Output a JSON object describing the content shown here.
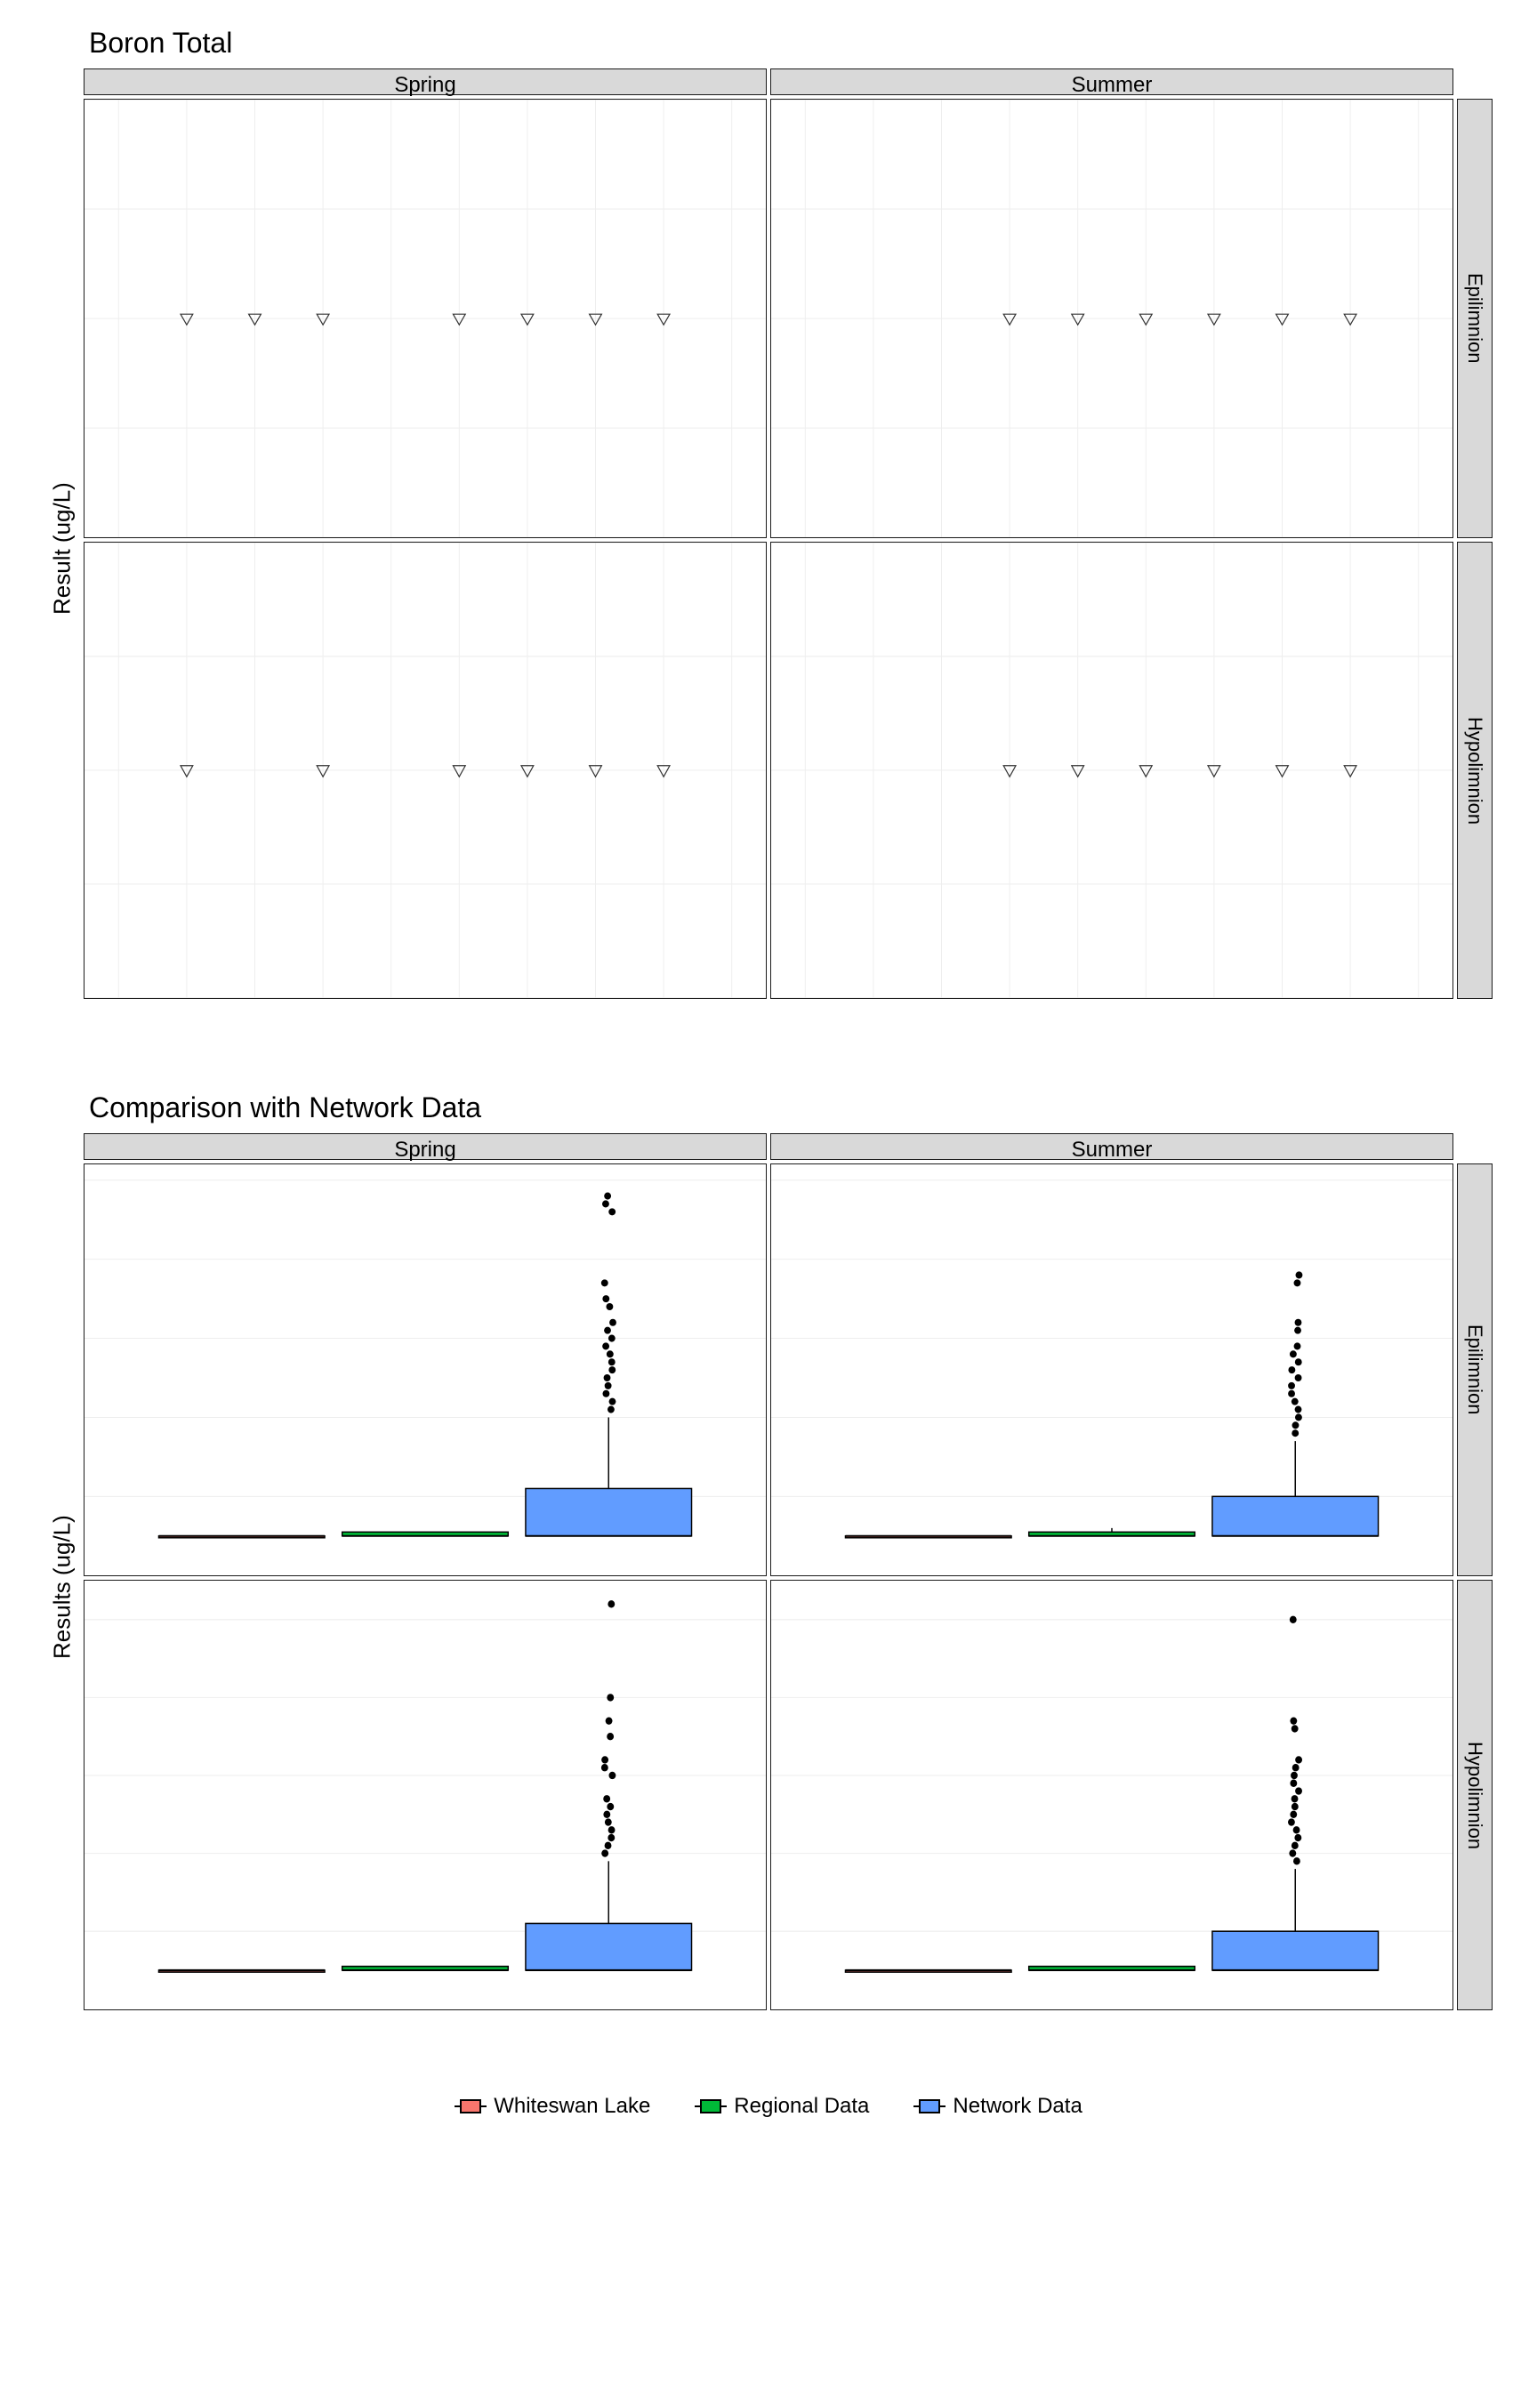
{
  "chart_data": [
    {
      "type": "scatter",
      "title": "Boron Total",
      "ylabel": "Result (ug/L)",
      "xlabel": "",
      "facet_cols": [
        "Spring",
        "Summer"
      ],
      "facet_rows": [
        "Epilimnion",
        "Hypolimnion"
      ],
      "xlim": [
        2015.5,
        2025.5
      ],
      "ylim": [
        4.95,
        5.05
      ],
      "x_ticks": [
        2016,
        2017,
        2018,
        2019,
        2020,
        2021,
        2022,
        2023,
        2024,
        2025
      ],
      "y_ticks": [
        4.95,
        4.975,
        5.0,
        5.025,
        5.05
      ],
      "marker": "open-down-triangle",
      "panels": {
        "Spring|Epilimnion": {
          "x": [
            2017,
            2018,
            2019,
            2021,
            2022,
            2023,
            2024
          ],
          "y": [
            5,
            5,
            5,
            5,
            5,
            5,
            5
          ]
        },
        "Summer|Epilimnion": {
          "x": [
            2019,
            2020,
            2021,
            2022,
            2023,
            2024
          ],
          "y": [
            5,
            5,
            5,
            5,
            5,
            5
          ]
        },
        "Spring|Hypolimnion": {
          "x": [
            2017,
            2019,
            2021,
            2022,
            2023,
            2024
          ],
          "y": [
            5,
            5,
            5,
            5,
            5,
            5
          ]
        },
        "Summer|Hypolimnion": {
          "x": [
            2019,
            2020,
            2021,
            2022,
            2023,
            2024
          ],
          "y": [
            5,
            5,
            5,
            5,
            5,
            5
          ]
        }
      }
    },
    {
      "type": "boxplot",
      "title": "Comparison with Network Data",
      "ylabel": "Results (ug/L)",
      "xlabel": "",
      "x_category": "Boron Total",
      "facet_cols": [
        "Spring",
        "Summer"
      ],
      "facet_rows": [
        "Epilimnion",
        "Hypolimnion"
      ],
      "series_names": [
        "Whiteswan Lake",
        "Regional Data",
        "Network Data"
      ],
      "series_colors": [
        "#F8766D",
        "#00BA38",
        "#619CFF"
      ],
      "panels": {
        "Spring|Epilimnion": {
          "ylim": [
            0,
            52
          ],
          "y_ticks": [
            10,
            20,
            30,
            40,
            50
          ],
          "boxes": [
            {
              "series": "Whiteswan Lake",
              "min": 5,
              "q1": 5,
              "med": 5,
              "q3": 5,
              "max": 5,
              "outliers": []
            },
            {
              "series": "Regional Data",
              "min": 5,
              "q1": 5,
              "med": 5,
              "q3": 5.5,
              "max": 5.5,
              "outliers": []
            },
            {
              "series": "Network Data",
              "min": 5,
              "q1": 5,
              "med": 5,
              "q3": 11,
              "max": 20,
              "outliers": [
                21,
                22,
                23,
                24,
                25,
                26,
                27,
                28,
                29,
                30,
                31,
                32,
                34,
                35,
                37,
                46,
                47,
                48
              ]
            }
          ]
        },
        "Summer|Epilimnion": {
          "ylim": [
            0,
            52
          ],
          "y_ticks": [
            10,
            20,
            30,
            40,
            50
          ],
          "boxes": [
            {
              "series": "Whiteswan Lake",
              "min": 5,
              "q1": 5,
              "med": 5,
              "q3": 5,
              "max": 5,
              "outliers": []
            },
            {
              "series": "Regional Data",
              "min": 5,
              "q1": 5,
              "med": 5,
              "q3": 5.5,
              "max": 6,
              "outliers": []
            },
            {
              "series": "Network Data",
              "min": 5,
              "q1": 5,
              "med": 5,
              "q3": 10,
              "max": 17,
              "outliers": [
                18,
                19,
                20,
                21,
                22,
                23,
                24,
                25,
                26,
                27,
                28,
                29,
                31,
                32,
                37,
                38
              ]
            }
          ]
        },
        "Spring|Hypolimnion": {
          "ylim": [
            0,
            55
          ],
          "y_ticks": [
            10,
            20,
            30,
            40,
            50
          ],
          "boxes": [
            {
              "series": "Whiteswan Lake",
              "min": 5,
              "q1": 5,
              "med": 5,
              "q3": 5,
              "max": 5,
              "outliers": []
            },
            {
              "series": "Regional Data",
              "min": 5,
              "q1": 5,
              "med": 5,
              "q3": 5.5,
              "max": 5.5,
              "outliers": []
            },
            {
              "series": "Network Data",
              "min": 5,
              "q1": 5,
              "med": 5,
              "q3": 11,
              "max": 19,
              "outliers": [
                20,
                21,
                22,
                23,
                24,
                25,
                26,
                27,
                30,
                31,
                32,
                35,
                37,
                40,
                52
              ]
            }
          ]
        },
        "Summer|Hypolimnion": {
          "ylim": [
            0,
            55
          ],
          "y_ticks": [
            10,
            20,
            30,
            40,
            50
          ],
          "boxes": [
            {
              "series": "Whiteswan Lake",
              "min": 5,
              "q1": 5,
              "med": 5,
              "q3": 5,
              "max": 5,
              "outliers": []
            },
            {
              "series": "Regional Data",
              "min": 5,
              "q1": 5,
              "med": 5,
              "q3": 5.5,
              "max": 5.5,
              "outliers": []
            },
            {
              "series": "Network Data",
              "min": 5,
              "q1": 5,
              "med": 5,
              "q3": 10,
              "max": 18,
              "outliers": [
                19,
                20,
                21,
                22,
                23,
                24,
                25,
                26,
                27,
                28,
                29,
                30,
                31,
                32,
                36,
                37,
                50
              ]
            }
          ]
        }
      }
    }
  ],
  "legend": {
    "items": [
      {
        "label": "Whiteswan Lake",
        "color": "#F8766D"
      },
      {
        "label": "Regional Data",
        "color": "#00BA38"
      },
      {
        "label": "Network Data",
        "color": "#619CFF"
      }
    ]
  }
}
